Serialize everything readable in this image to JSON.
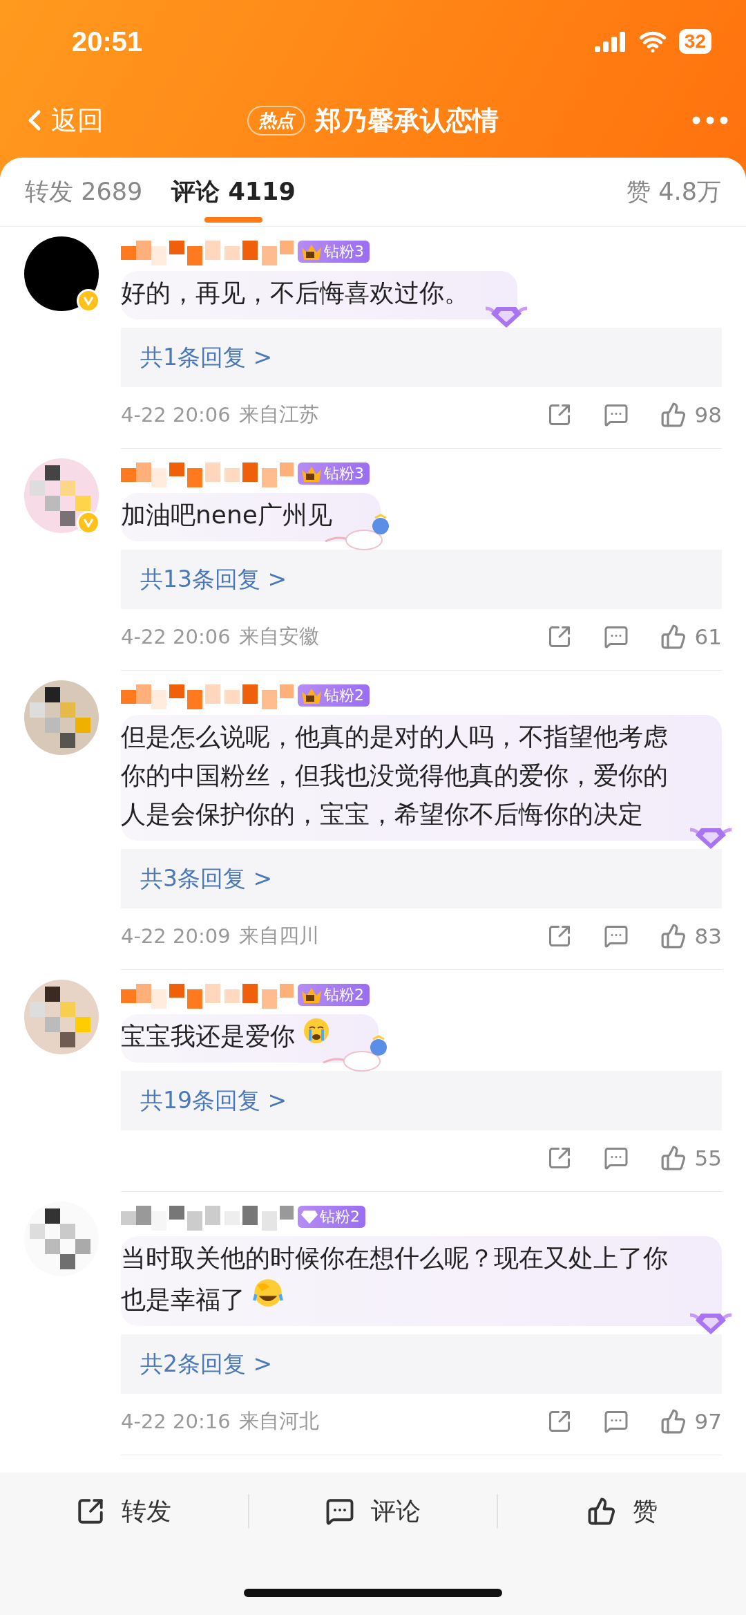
{
  "status_bar": {
    "time": "20:51",
    "battery": "32"
  },
  "nav": {
    "back": "返回",
    "tag": "热点",
    "title": "郑乃馨承认恋情"
  },
  "tabs": [
    {
      "label": "转发 2689",
      "selected": false
    },
    {
      "label": "评论 4119",
      "selected": true
    }
  ],
  "likes_tab": "赞 4.8万",
  "comments": [
    {
      "avatar": {
        "kind": "black"
      },
      "verified": true,
      "vip": true,
      "badge": {
        "kind": "crown",
        "label": "钻粉3"
      },
      "text": "好的，再见，不后悔喜欢过你。",
      "decoration": {
        "kind": "diamond"
      },
      "replies": "共1条回复 >",
      "date": "4-22 20:06",
      "location": "来自江苏",
      "likes": "98"
    },
    {
      "verified": true,
      "vip": true,
      "badge": {
        "kind": "crown",
        "label": "钻粉3"
      },
      "text": "加油吧nene广州见",
      "decoration": {
        "kind": "sticker"
      },
      "replies": "共13条回复 >",
      "date": "4-22 20:06",
      "location": "来自安徽",
      "likes": "61"
    },
    {
      "verified": false,
      "vip": true,
      "badge": {
        "kind": "crown",
        "label": "钻粉2"
      },
      "text": "但是怎么说呢，他真的是对的人吗，不指望他考虑你的中国粉丝，但我也没觉得他真的爱你，爱你的人是会保护你的，宝宝，希望你不后悔你的决定",
      "decoration": {
        "kind": "diamond"
      },
      "replies": "共3条回复 >",
      "date": "4-22 20:09",
      "location": "来自四川",
      "likes": "83"
    },
    {
      "verified": false,
      "vip": true,
      "badge": {
        "kind": "crown",
        "label": "钻粉2"
      },
      "text": "宝宝我还是爱你",
      "emoji": {
        "kind": "crying"
      },
      "decoration": {
        "kind": "sticker"
      },
      "replies": "共19条回复 >",
      "likes": "55"
    },
    {
      "verified": false,
      "vip": false,
      "badge": {
        "kind": "diamond",
        "label": "钻粉2"
      },
      "text": "当时取关他的时候你在想什么呢？现在又处上了你也是幸福了",
      "emoji": {
        "kind": "laughing"
      },
      "decoration": {
        "kind": "diamond"
      },
      "replies": "共2条回复 >",
      "date": "4-22 20:16",
      "location": "来自河北",
      "likes": "97"
    }
  ],
  "bottom_bar": [
    {
      "kind": "repost",
      "label": "转发"
    },
    {
      "kind": "comment",
      "label": "评论"
    },
    {
      "kind": "like",
      "label": "赞"
    }
  ]
}
